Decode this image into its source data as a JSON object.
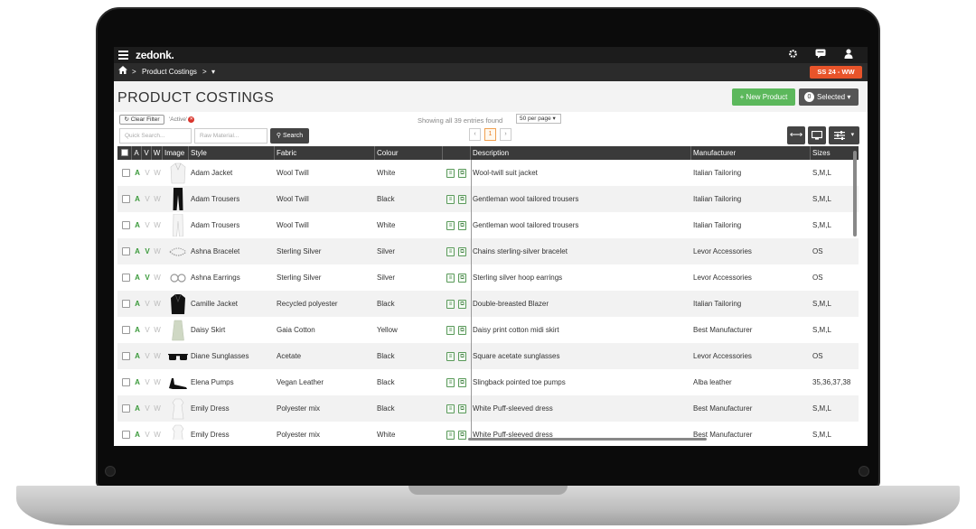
{
  "app": {
    "logo": "zedonk.",
    "season_badge": "SS 24 - WW"
  },
  "breadcrumb": {
    "separator": ">",
    "items": [
      "Product Costings"
    ],
    "dropdown": "▾"
  },
  "page": {
    "title": "PRODUCT COSTINGS",
    "new_product_label": "+ New Product",
    "selected_count": "0",
    "selected_label": "Selected ▾"
  },
  "filters": {
    "clear_filter_label": "Clear Filter",
    "active_tag": "'Active'",
    "showing_text": "Showing all 39 entries found",
    "per_page": "50 per page ▾",
    "quick_search_placeholder": "Quick Search...",
    "raw_material_placeholder": "Raw Material...",
    "search_label": "Search",
    "pager_prev": "‹",
    "pager_current": "1",
    "pager_next": "›"
  },
  "table": {
    "headers": {
      "a": "A",
      "v": "V",
      "w": "W",
      "image": "Image",
      "style": "Style",
      "fabric": "Fabric",
      "colour": "Colour",
      "description": "Description",
      "manufacturer": "Manufacturer",
      "sizes": "Sizes"
    },
    "rows": [
      {
        "a": "A",
        "v": "V",
        "w": "W",
        "v_on": false,
        "style": "Adam Jacket",
        "fabric": "Wool Twill",
        "colour": "White",
        "description": "Wool-twill suit jacket",
        "manufacturer": "Italian Tailoring",
        "sizes": "S,M,L",
        "image": "jacket-white"
      },
      {
        "a": "A",
        "v": "V",
        "w": "W",
        "v_on": false,
        "style": "Adam Trousers",
        "fabric": "Wool Twill",
        "colour": "Black",
        "description": "Gentleman wool tailored trousers",
        "manufacturer": "Italian Tailoring",
        "sizes": "S,M,L",
        "image": "trousers-black"
      },
      {
        "a": "A",
        "v": "V",
        "w": "W",
        "v_on": false,
        "style": "Adam Trousers",
        "fabric": "Wool Twill",
        "colour": "White",
        "description": "Gentleman wool tailored trousers",
        "manufacturer": "Italian Tailoring",
        "sizes": "S,M,L",
        "image": "trousers-white"
      },
      {
        "a": "A",
        "v": "V",
        "w": "W",
        "v_on": true,
        "style": "Ashna Bracelet",
        "fabric": "Sterling Silver",
        "colour": "Silver",
        "description": "Chains sterling-silver bracelet",
        "manufacturer": "Levor Accessories",
        "sizes": "OS",
        "image": "bracelet"
      },
      {
        "a": "A",
        "v": "V",
        "w": "W",
        "v_on": true,
        "style": "Ashna Earrings",
        "fabric": "Sterling Silver",
        "colour": "Silver",
        "description": "Sterling silver hoop earrings",
        "manufacturer": "Levor Accessories",
        "sizes": "OS",
        "image": "earrings"
      },
      {
        "a": "A",
        "v": "V",
        "w": "W",
        "v_on": false,
        "style": "Camille Jacket",
        "fabric": "Recycled polyester",
        "colour": "Black",
        "description": "Double-breasted Blazer",
        "manufacturer": "Italian Tailoring",
        "sizes": "S,M,L",
        "image": "jacket-black"
      },
      {
        "a": "A",
        "v": "V",
        "w": "W",
        "v_on": false,
        "style": "Daisy Skirt",
        "fabric": "Gaia Cotton",
        "colour": "Yellow",
        "description": "Daisy print cotton midi skirt",
        "manufacturer": "Best Manufacturer",
        "sizes": "S,M,L",
        "image": "skirt"
      },
      {
        "a": "A",
        "v": "V",
        "w": "W",
        "v_on": false,
        "style": "Diane Sunglasses",
        "fabric": "Acetate",
        "colour": "Black",
        "description": "Square acetate sunglasses",
        "manufacturer": "Levor Accessories",
        "sizes": "OS",
        "image": "sunglasses"
      },
      {
        "a": "A",
        "v": "V",
        "w": "W",
        "v_on": false,
        "style": "Elena Pumps",
        "fabric": "Vegan Leather",
        "colour": "Black",
        "description": "Slingback pointed toe pumps",
        "manufacturer": "Alba leather",
        "sizes": "35,36,37,38",
        "image": "pumps"
      },
      {
        "a": "A",
        "v": "V",
        "w": "W",
        "v_on": false,
        "style": "Emily Dress",
        "fabric": "Polyester mix",
        "colour": "Black",
        "description": "White Puff-sleeved dress",
        "manufacturer": "Best Manufacturer",
        "sizes": "S,M,L",
        "image": "dress"
      },
      {
        "a": "A",
        "v": "V",
        "w": "W",
        "v_on": false,
        "style": "Emily Dress",
        "fabric": "Polyester mix",
        "colour": "White",
        "description": "White Puff-sleeved dress",
        "manufacturer": "Best Manufacturer",
        "sizes": "S,M,L",
        "image": "dress"
      }
    ]
  },
  "colors": {
    "topbar": "#1c1c1c",
    "accent_orange": "#e8542a",
    "new_button": "#5cb85c",
    "flag_green": "#3b9a3b"
  }
}
